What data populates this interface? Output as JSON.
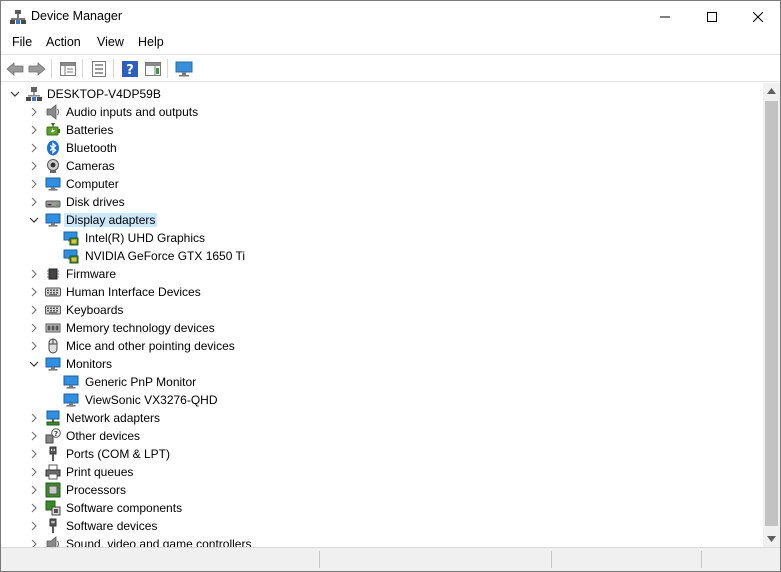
{
  "window": {
    "title": "Device Manager"
  },
  "menu": {
    "file": "File",
    "action": "Action",
    "view": "View",
    "help": "Help"
  },
  "tree": {
    "root": "DESKTOP-V4DP59B",
    "categories": [
      {
        "label": "Audio inputs and outputs",
        "icon": "speaker-icon",
        "expanded": false
      },
      {
        "label": "Batteries",
        "icon": "battery-icon",
        "expanded": false
      },
      {
        "label": "Bluetooth",
        "icon": "bluetooth-icon",
        "expanded": false
      },
      {
        "label": "Cameras",
        "icon": "camera-icon",
        "expanded": false
      },
      {
        "label": "Computer",
        "icon": "monitor-icon",
        "expanded": false
      },
      {
        "label": "Disk drives",
        "icon": "disk-drive-icon",
        "expanded": false
      },
      {
        "label": "Display adapters",
        "icon": "display-adapter-icon",
        "expanded": true,
        "selected": true,
        "children": [
          "Intel(R) UHD Graphics",
          "NVIDIA GeForce GTX 1650 Ti"
        ]
      },
      {
        "label": "Firmware",
        "icon": "chip-icon",
        "expanded": false
      },
      {
        "label": "Human Interface Devices",
        "icon": "keyboard-icon",
        "expanded": false
      },
      {
        "label": "Keyboards",
        "icon": "keyboard-icon",
        "expanded": false
      },
      {
        "label": "Memory technology devices",
        "icon": "memory-icon",
        "expanded": false
      },
      {
        "label": "Mice and other pointing devices",
        "icon": "mouse-icon",
        "expanded": false
      },
      {
        "label": "Monitors",
        "icon": "monitor-icon",
        "expanded": true,
        "children": [
          "Generic PnP Monitor",
          "ViewSonic VX3276-QHD"
        ]
      },
      {
        "label": "Network adapters",
        "icon": "network-icon",
        "expanded": false
      },
      {
        "label": "Other devices",
        "icon": "unknown-device-icon",
        "expanded": false
      },
      {
        "label": "Ports (COM & LPT)",
        "icon": "port-icon",
        "expanded": false
      },
      {
        "label": "Print queues",
        "icon": "printer-icon",
        "expanded": false
      },
      {
        "label": "Processors",
        "icon": "processor-icon",
        "expanded": false
      },
      {
        "label": "Software components",
        "icon": "software-component-icon",
        "expanded": false
      },
      {
        "label": "Software devices",
        "icon": "software-device-icon",
        "expanded": false
      },
      {
        "label": "Sound, video and game controllers",
        "icon": "speaker-icon",
        "expanded": false
      }
    ]
  },
  "colors": {
    "selection": "#cce8ff",
    "accent": "#0078d7"
  }
}
